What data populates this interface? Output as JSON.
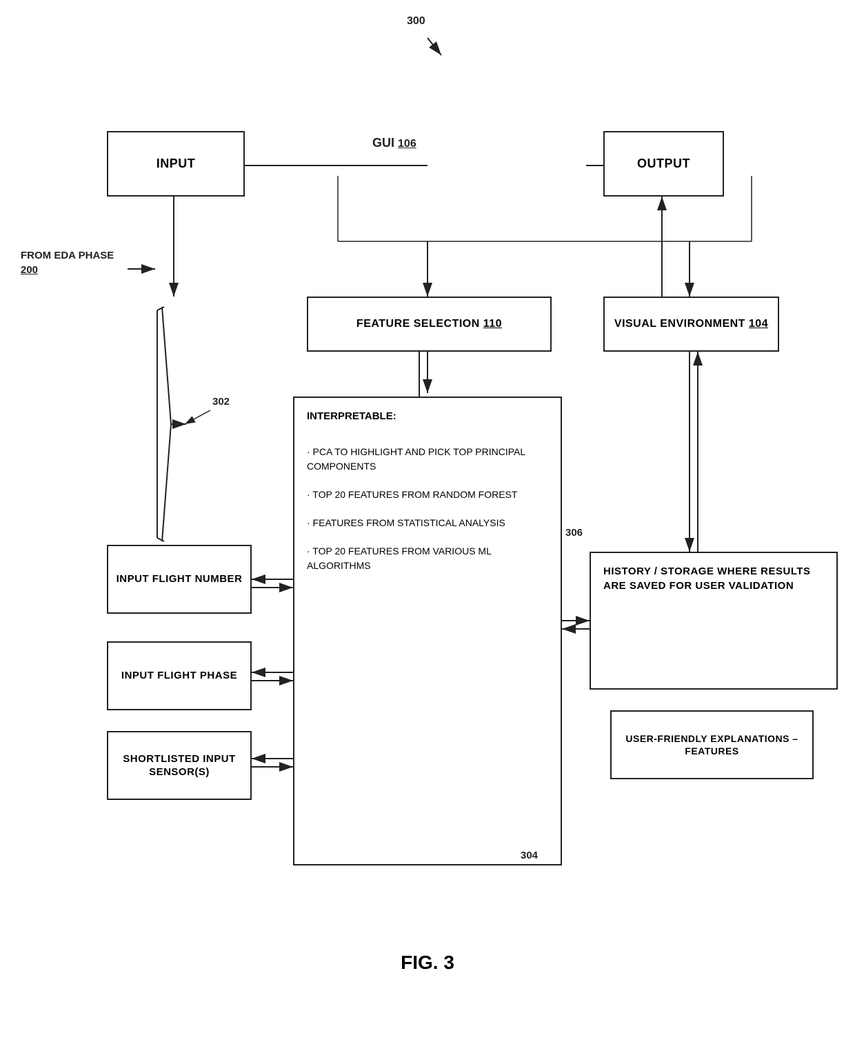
{
  "diagram": {
    "title": "300",
    "fig_label": "FIG. 3",
    "nodes": {
      "input_box": {
        "label": "INPUT"
      },
      "gui_label": "GUI",
      "gui_ref": "106",
      "output_box": {
        "label": "OUTPUT"
      },
      "from_eda": "FROM EDA PHASE",
      "from_eda_ref": "200",
      "feature_selection": "FEATURE SELECTION",
      "feature_selection_ref": "110",
      "visual_env": "VISUAL ENVIRONMENT",
      "visual_env_ref": "104",
      "input_flight_number": "INPUT FLIGHT NUMBER",
      "input_flight_phase": "INPUT FLIGHT PHASE",
      "shortlisted_input": "SHORTLISTED INPUT SENSOR(S)",
      "history_storage": "HISTORY / STORAGE WHERE RESULTS ARE SAVED FOR USER VALIDATION",
      "user_friendly": "USER-FRIENDLY EXPLANATIONS – FEATURES",
      "interpretable_title": "INTERPRETABLE:",
      "bullet1": "· PCA TO HIGHLIGHT AND PICK TOP PRINCIPAL COMPONENTS",
      "bullet2": "· TOP 20 FEATURES FROM RANDOM FOREST",
      "bullet3": "· FEATURES FROM STATISTICAL ANALYSIS",
      "bullet4": "· TOP 20 FEATURES FROM VARIOUS ML ALGORITHMS",
      "ref_302": "302",
      "ref_304": "304",
      "ref_306": "306"
    }
  }
}
